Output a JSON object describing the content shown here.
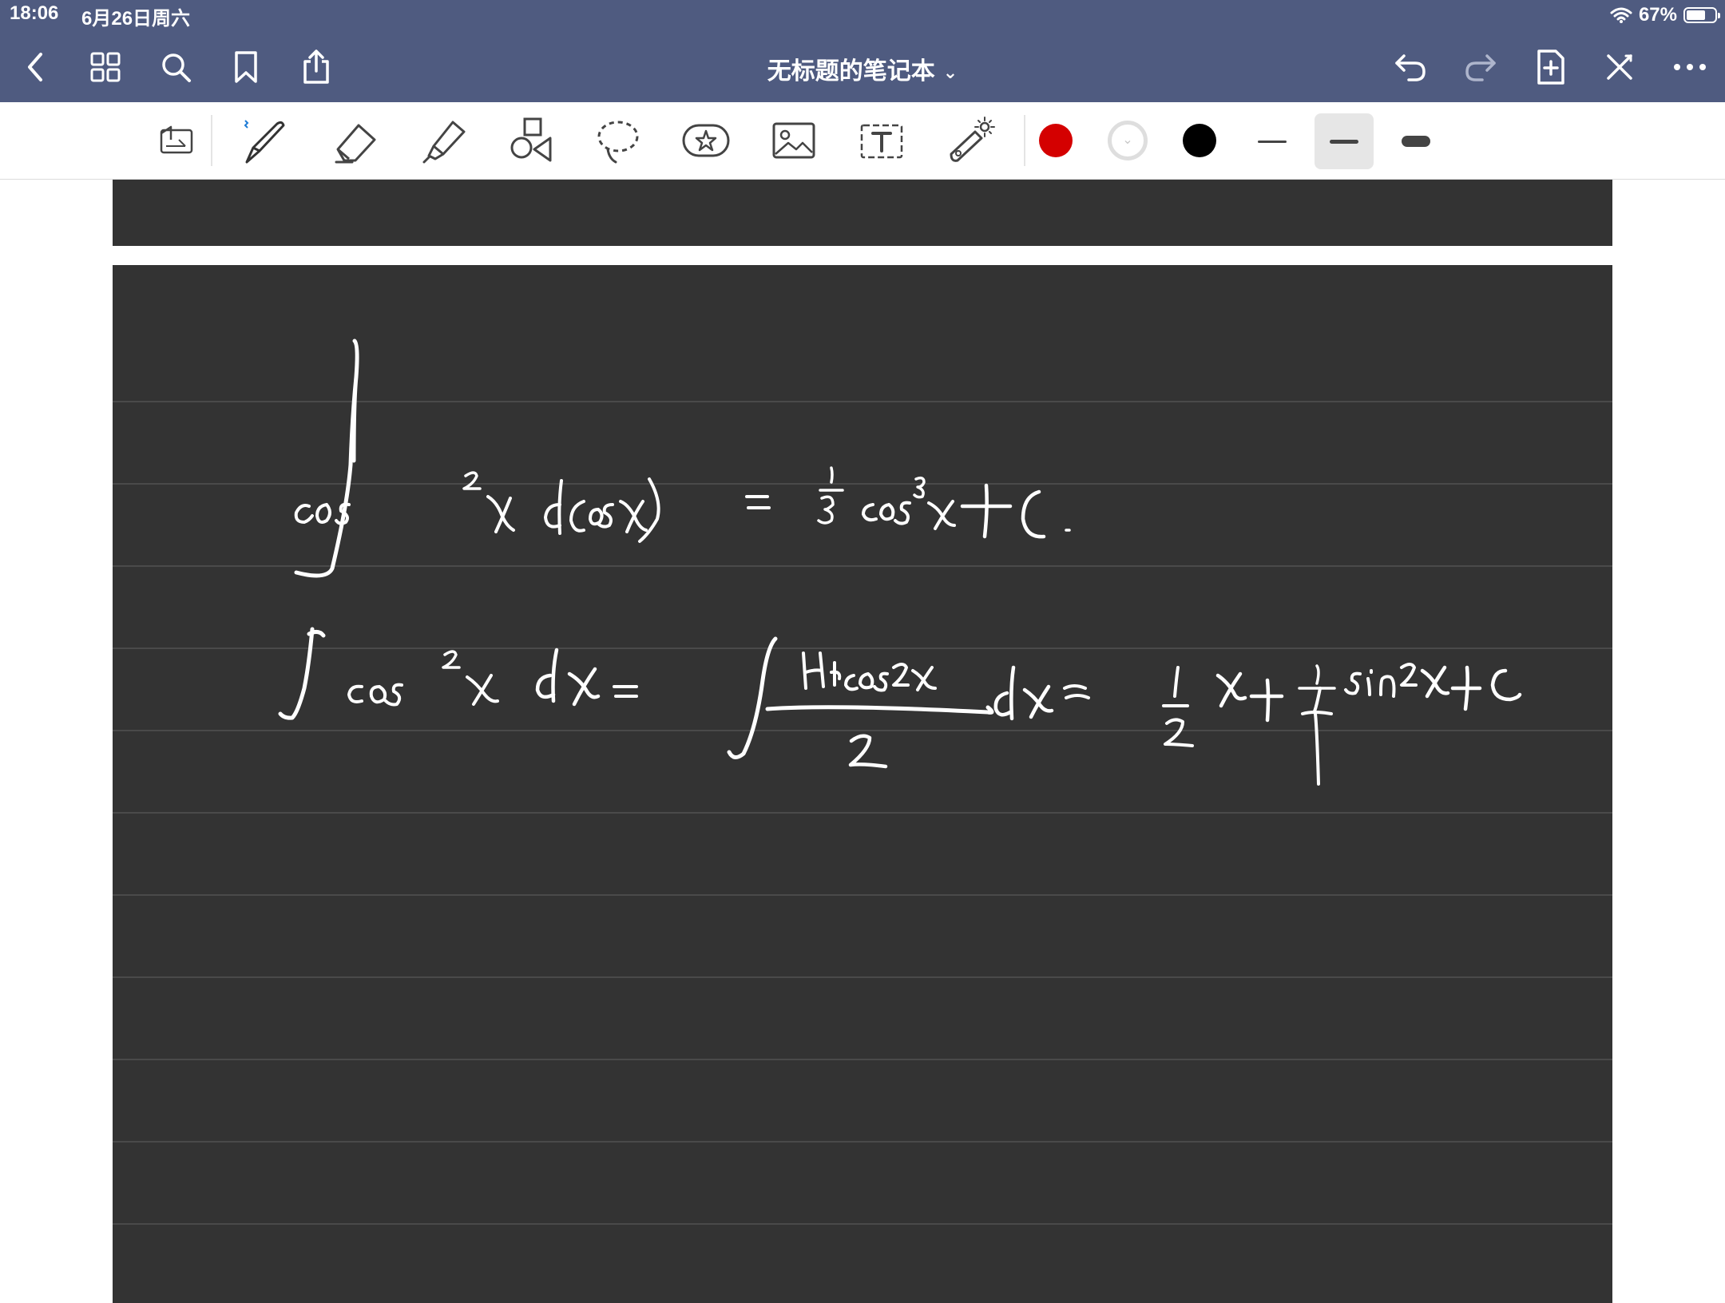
{
  "status": {
    "time": "18:06",
    "date": "6月26日周六",
    "battery_percent": "67%",
    "battery_level": 0.67
  },
  "nav": {
    "title": "无标题的笔记本",
    "left_icons": [
      "back-icon",
      "grid-icon",
      "search-icon",
      "bookmark-icon",
      "share-icon"
    ],
    "right_icons": [
      "undo-icon",
      "redo-icon",
      "add-page-icon",
      "laser-off-icon",
      "more-icon"
    ]
  },
  "toolbar": {
    "tools": [
      "page-layout-icon",
      "pen-icon",
      "eraser-icon",
      "highlighter-icon",
      "shapes-icon",
      "lasso-icon",
      "sticker-icon",
      "image-icon",
      "text-icon",
      "laser-pointer-icon"
    ],
    "selected_tool": "pen-icon",
    "colors": [
      "#d40000",
      "#ffffff",
      "#000000"
    ],
    "stroke_widths": [
      "thin",
      "medium",
      "thick"
    ],
    "selected_stroke": "medium"
  },
  "note": {
    "paper": "dark-ruled",
    "handwriting_lines": 2
  }
}
